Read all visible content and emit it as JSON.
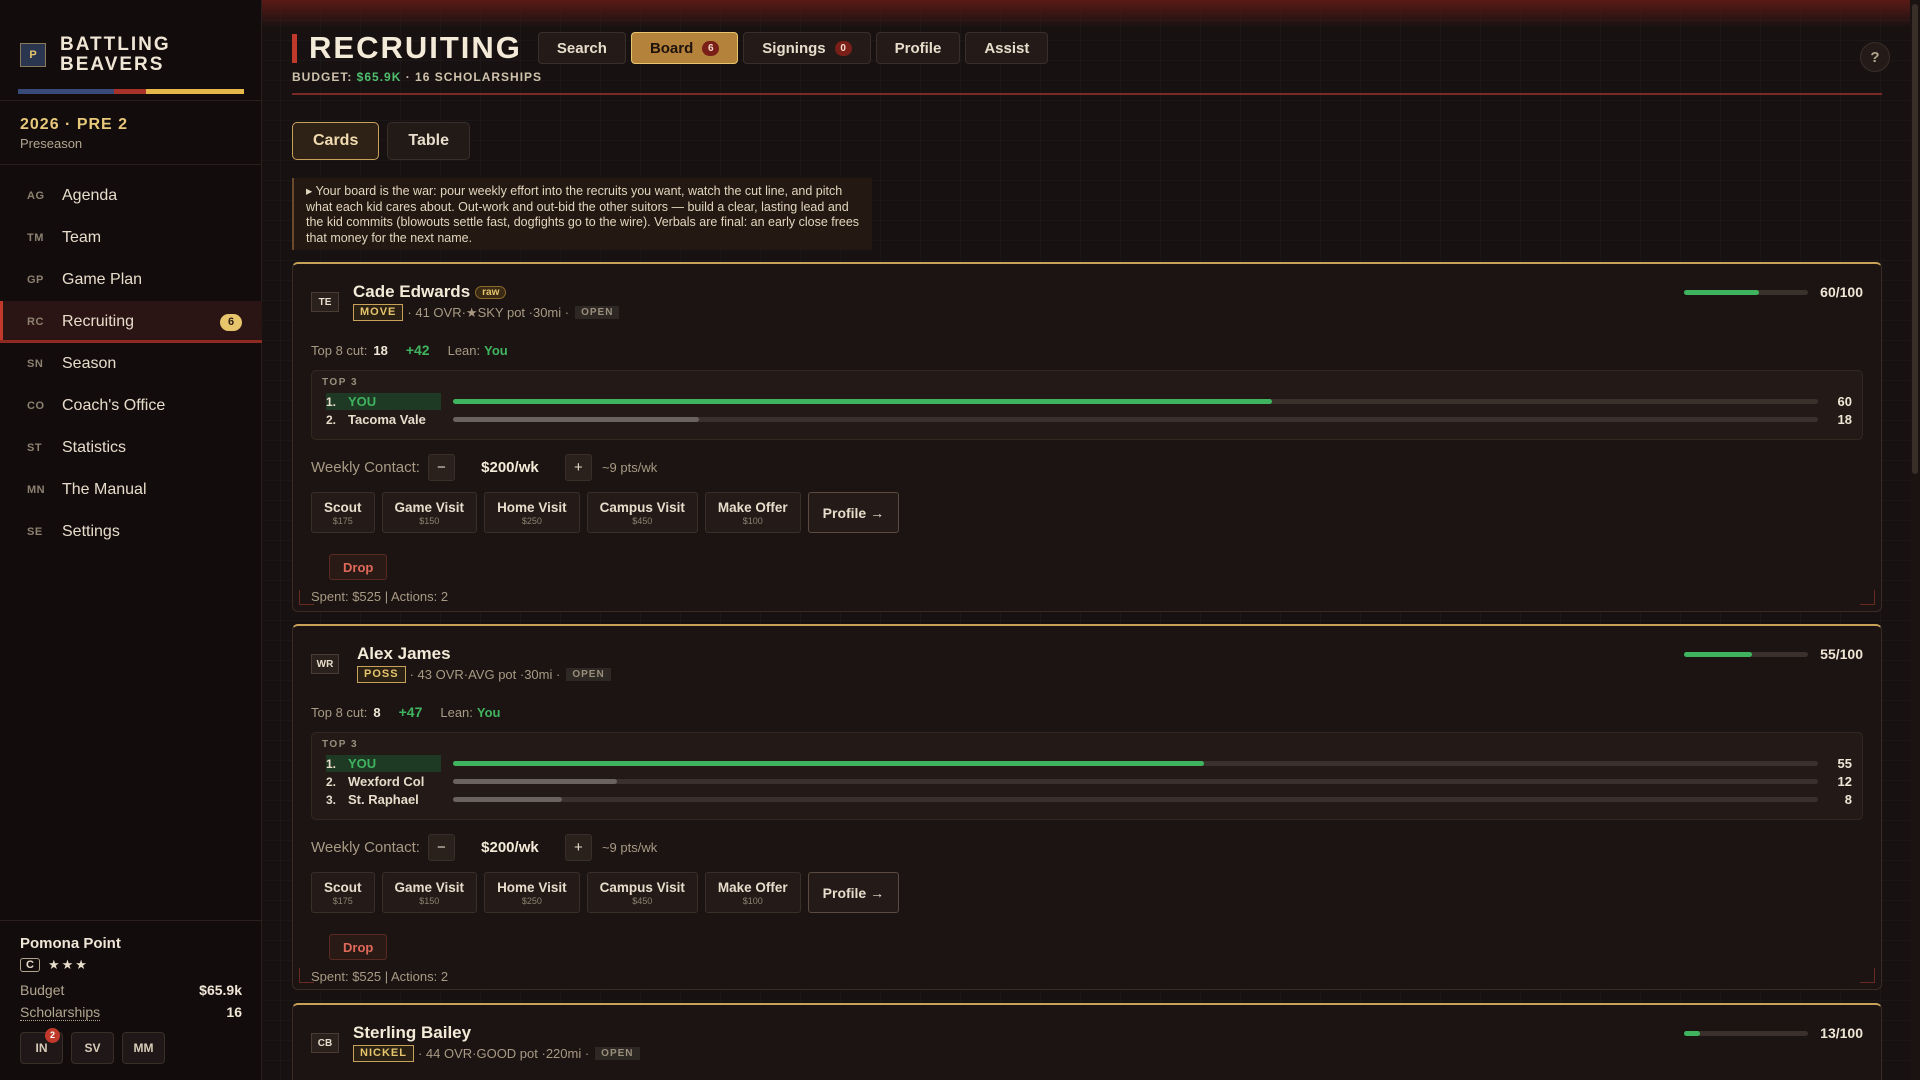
{
  "brand": {
    "logo_text": "P",
    "name_line1": "BATTLING",
    "name_line2": "BEAVERS",
    "stripe_colors": [
      "#3a4a78",
      "#a8322a",
      "#e6b84a"
    ]
  },
  "season": {
    "title": "2026 · PRE 2",
    "subtitle": "Preseason"
  },
  "nav": [
    {
      "abbr": "AG",
      "label": "Agenda",
      "icon": "agenda-icon"
    },
    {
      "abbr": "TM",
      "label": "Team",
      "icon": "team-icon"
    },
    {
      "abbr": "GP",
      "label": "Game Plan",
      "icon": "game-plan-icon"
    },
    {
      "abbr": "RC",
      "label": "Recruiting",
      "icon": "recruiting-icon",
      "badge": "6",
      "active": true
    },
    {
      "abbr": "SN",
      "label": "Season",
      "icon": "season-icon"
    },
    {
      "abbr": "CO",
      "label": "Coach's Office",
      "icon": "coach-office-icon"
    },
    {
      "abbr": "ST",
      "label": "Statistics",
      "icon": "statistics-icon"
    },
    {
      "abbr": "MN",
      "label": "The Manual",
      "icon": "manual-icon"
    },
    {
      "abbr": "SE",
      "label": "Settings",
      "icon": "settings-icon"
    }
  ],
  "team": {
    "name": "Pomona Point",
    "grade": "C",
    "stars": "★★★",
    "budget_label": "Budget",
    "budget_value": "$65.9k",
    "scholarships_label": "Scholarships",
    "scholarships_value": "16",
    "mini_buttons": [
      {
        "label": "IN",
        "badge": "2"
      },
      {
        "label": "SV"
      },
      {
        "label": "MM"
      }
    ]
  },
  "header": {
    "title": "RECRUITING",
    "tabs": [
      {
        "label": "Search"
      },
      {
        "label": "Board",
        "badge": "6",
        "active": true
      },
      {
        "label": "Signings",
        "badge": "0"
      },
      {
        "label": "Profile"
      },
      {
        "label": "Assist"
      }
    ],
    "budget_prefix": "BUDGET: ",
    "budget_value": "$65.9K",
    "budget_suffix": " · 16 SCHOLARSHIPS",
    "help": "?"
  },
  "view_toggle": [
    {
      "label": "Cards",
      "active": true
    },
    {
      "label": "Table"
    }
  ],
  "info_text": "▸ Your board is the war: pour weekly effort into the recruits you want, watch the cut line, and pitch what each kid cares about. Out-work and out-bid the other suitors — build a clear, lasting lead and the kid commits (blowouts settle fast, dogfights go to the wire). Verbals are final: an early close frees that money for the next name.",
  "labels": {
    "top8_cut": "Top 8 cut:",
    "lean": "Lean:",
    "top3": "TOP 3",
    "weekly_contact": "Weekly Contact:",
    "minus": "−",
    "plus": "+",
    "drop": "Drop"
  },
  "actions": [
    {
      "label": "Scout",
      "cost": "$175"
    },
    {
      "label": "Game Visit",
      "cost": "$150"
    },
    {
      "label": "Home Visit",
      "cost": "$250"
    },
    {
      "label": "Campus Visit",
      "cost": "$450"
    },
    {
      "label": "Make Offer",
      "cost": "$100"
    }
  ],
  "profile_action": "Profile →",
  "recruits": [
    {
      "pos": "TE",
      "name": "Cade Edwards",
      "tag": "raw",
      "archetype": "MOVE",
      "meta": "· 41 OVR·★SKY pot ·30mi ·",
      "status": "OPEN",
      "interest": 60,
      "interest_label": "60/100",
      "cut": "18",
      "delta": "+42",
      "lean": "You",
      "top3": [
        {
          "rank": "1.",
          "name": "YOU",
          "value": 60,
          "you": true
        },
        {
          "rank": "2.",
          "name": "Tacoma Vale",
          "value": 18
        }
      ],
      "weekly": "$200/wk",
      "weekly_note": "~9 pts/wk",
      "spent": "Spent: $525 | Actions: 2"
    },
    {
      "pos": "WR",
      "name": "Alex James",
      "archetype": "POSS",
      "meta": "· 43 OVR·AVG pot ·30mi ·",
      "status": "OPEN",
      "interest": 55,
      "interest_label": "55/100",
      "cut": "8",
      "delta": "+47",
      "lean": "You",
      "top3": [
        {
          "rank": "1.",
          "name": "YOU",
          "value": 55,
          "you": true
        },
        {
          "rank": "2.",
          "name": "Wexford Col",
          "value": 12
        },
        {
          "rank": "3.",
          "name": "St. Raphael",
          "value": 8
        }
      ],
      "weekly": "$200/wk",
      "weekly_note": "~9 pts/wk",
      "spent": "Spent: $525 | Actions: 2"
    },
    {
      "pos": "CB",
      "name": "Sterling Bailey",
      "archetype": "NICKEL",
      "meta": "· 44 OVR·GOOD pot ·220mi ·",
      "status": "OPEN",
      "interest": 13,
      "interest_label": "13/100"
    }
  ]
}
